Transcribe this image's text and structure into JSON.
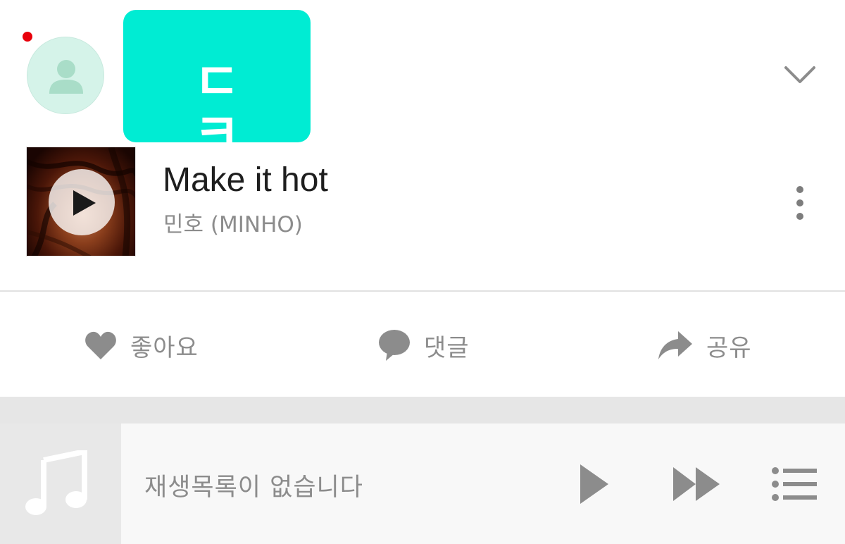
{
  "header": {
    "notification_color": "#e8000b",
    "avatar_icon": "person-icon",
    "user_tile_text": "ㄷ ㅋ",
    "user_tile_color": "#00ecd3",
    "collapse_icon": "chevron-down-icon"
  },
  "track": {
    "title": "Make it hot",
    "artist": "민호 (MINHO)",
    "art_overlay_icon": "play-icon",
    "menu_icon": "more-vertical-icon"
  },
  "actions": {
    "like": {
      "label": "좋아요",
      "icon": "heart-icon"
    },
    "comment": {
      "label": "댓글",
      "icon": "comment-bubble-icon"
    },
    "share": {
      "label": "공유",
      "icon": "share-arrow-icon"
    }
  },
  "mini_player": {
    "art_icon": "music-note-icon",
    "status_text": "재생목록이 없습니다",
    "controls": [
      "play-icon",
      "fast-forward-icon",
      "playlist-icon"
    ]
  },
  "colors": {
    "icon_gray": "#8c8c8c",
    "text_dark": "#1e1e1e"
  }
}
